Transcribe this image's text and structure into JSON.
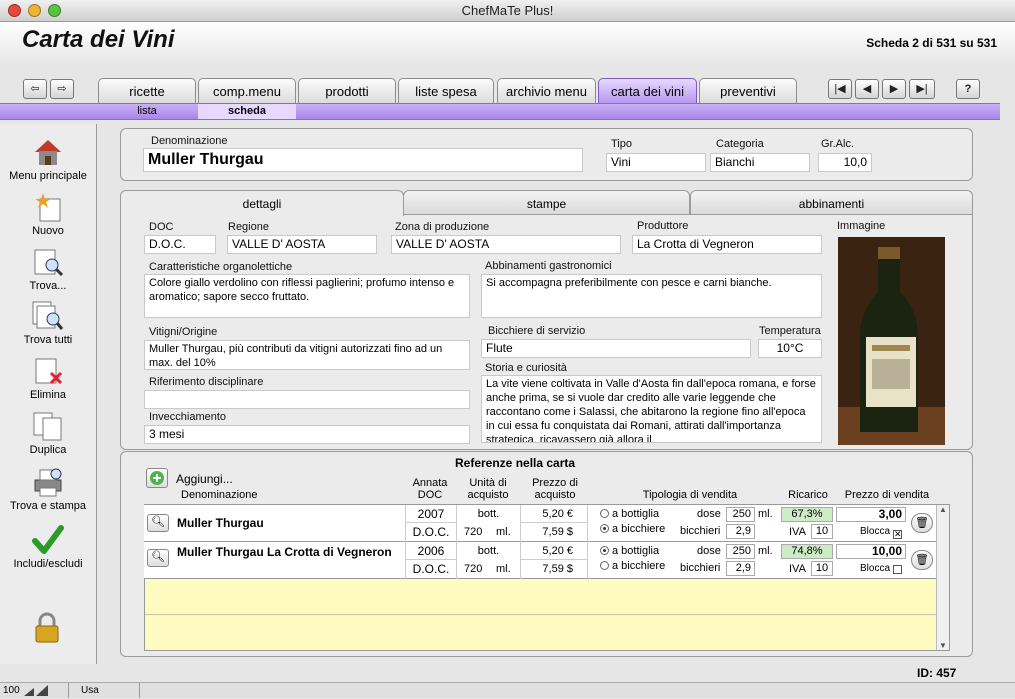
{
  "window": {
    "title": "ChefMaTe Plus!"
  },
  "header": {
    "title": "Carta dei Vini",
    "record_info": "Scheda 2 di 531 su 531"
  },
  "tabs": [
    {
      "label": "ricette"
    },
    {
      "label": "comp.menu"
    },
    {
      "label": "prodotti"
    },
    {
      "label": "liste spesa"
    },
    {
      "label": "archivio menu"
    },
    {
      "label": "carta dei vini"
    },
    {
      "label": "preventivi"
    }
  ],
  "subtabs": {
    "lista": "lista",
    "scheda": "scheda"
  },
  "help_label": "?",
  "sidebar": [
    {
      "label": "Menu principale",
      "icon": "home-icon"
    },
    {
      "label": "Nuovo",
      "icon": "new-record-icon"
    },
    {
      "label": "Trova...",
      "icon": "find-icon"
    },
    {
      "label": "Trova tutti",
      "icon": "find-all-icon"
    },
    {
      "label": "Elimina",
      "icon": "delete-icon"
    },
    {
      "label": "Duplica",
      "icon": "duplicate-icon"
    },
    {
      "label": "Trova e stampa",
      "icon": "print-icon"
    },
    {
      "label": "Includi/escludi",
      "icon": "checkmark-icon"
    }
  ],
  "record": {
    "denominazione_label": "Denominazione",
    "denominazione": "Muller Thurgau",
    "tipo_label": "Tipo",
    "tipo": "Vini",
    "categoria_label": "Categoria",
    "categoria": "Bianchi",
    "gradazione_label": "Gr.Alc.",
    "gradazione": "10,0"
  },
  "detail_tabs": {
    "dettagli": "dettagli",
    "stampe": "stampe",
    "abbinamenti": "abbinamenti"
  },
  "details": {
    "doc_label": "DOC",
    "doc": "D.O.C.",
    "regione_label": "Regione",
    "regione": "VALLE D' AOSTA",
    "zona_label": "Zona di produzione",
    "zona": "VALLE D' AOSTA",
    "produttore_label": "Produttore",
    "produttore": "La Crotta di Vegneron",
    "immagine_label": "Immagine",
    "caratteristiche_label": "Caratteristiche organolettiche",
    "caratteristiche": "Colore giallo verdolino con riflessi paglierini; profumo intenso e aromatico; sapore secco fruttato.",
    "abbinamenti_label": "Abbinamenti gastronomici",
    "abbinamenti": "Si accompagna preferibilmente con pesce e carni bianche.",
    "vitigni_label": "Vitigni/Origine",
    "vitigni": "Muller Thurgau, più contributi da vitigni autorizzati fino ad un max. del 10%",
    "bicchiere_label": "Bicchiere di servizio",
    "bicchiere": "Flute",
    "temperatura_label": "Temperatura",
    "temperatura": "10°C",
    "riferimento_label": "Riferimento disciplinare",
    "riferimento": "",
    "storia_label": "Storia e curiosità",
    "storia": "La vite viene coltivata in Valle d'Aosta fin dall'epoca romana, e forse anche prima, se si vuole dar credito alle varie leggende che raccontano come i Salassi, che abitarono la regione fino all'epoca in cui essa fu conquistata dai Romani, attirati dall'importanza strategica, ricavassero già allora il",
    "invecchiamento_label": "Invecchiamento",
    "invecchiamento": "3 mesi"
  },
  "referenze": {
    "title": "Referenze nella carta",
    "add_label": "Aggiungi...",
    "headers": {
      "denominazione": "Denominazione",
      "annata": "Annata",
      "doc": "DOC",
      "unita1": "Unità di",
      "unita2": "acquisto",
      "prezzo1": "Prezzo di",
      "prezzo2": "acquisto",
      "tipologia": "Tipologia di vendita",
      "ricarico": "Ricarico",
      "vendita": "Prezzo di vendita"
    },
    "rows": [
      {
        "name": "Muller Thurgau",
        "annata": "2007",
        "doc": "D.O.C.",
        "unit": "bott.",
        "qty": "720",
        "qty_unit": "ml.",
        "price_eur": "5,20 €",
        "price_usd": "7,59 $",
        "opt_bottiglia": "a bottiglia",
        "opt_bicchiere": "a bicchiere",
        "selected": "bicchiere",
        "dose_label": "dose",
        "dose": "250",
        "dose_unit": "ml.",
        "bicchieri_label": "bicchieri",
        "bicchieri": "2,9",
        "ricarico": "67,3%",
        "iva_label": "IVA",
        "iva": "10",
        "vendita": "3,00",
        "blocca_label": "Blocca",
        "blocca": true
      },
      {
        "name": "Muller Thurgau La Crotta di Vegneron",
        "annata": "2006",
        "doc": "D.O.C.",
        "unit": "bott.",
        "qty": "720",
        "qty_unit": "ml.",
        "price_eur": "5,20 €",
        "price_usd": "7,59 $",
        "opt_bottiglia": "a bottiglia",
        "opt_bicchiere": "a bicchiere",
        "selected": "bottiglia",
        "dose_label": "dose",
        "dose": "250",
        "dose_unit": "ml.",
        "bicchieri_label": "bicchieri",
        "bicchieri": "2,9",
        "ricarico": "74,8%",
        "iva_label": "IVA",
        "iva": "10",
        "vendita": "10,00",
        "blocca_label": "Blocca",
        "blocca": false
      }
    ]
  },
  "footer": {
    "id": "ID: 457",
    "zoom": "100",
    "mode": "Usa"
  },
  "colors": {
    "accent": "#b698ee",
    "ricarico_bg": "#cdebc6",
    "table_bg": "#fdfbc0"
  }
}
